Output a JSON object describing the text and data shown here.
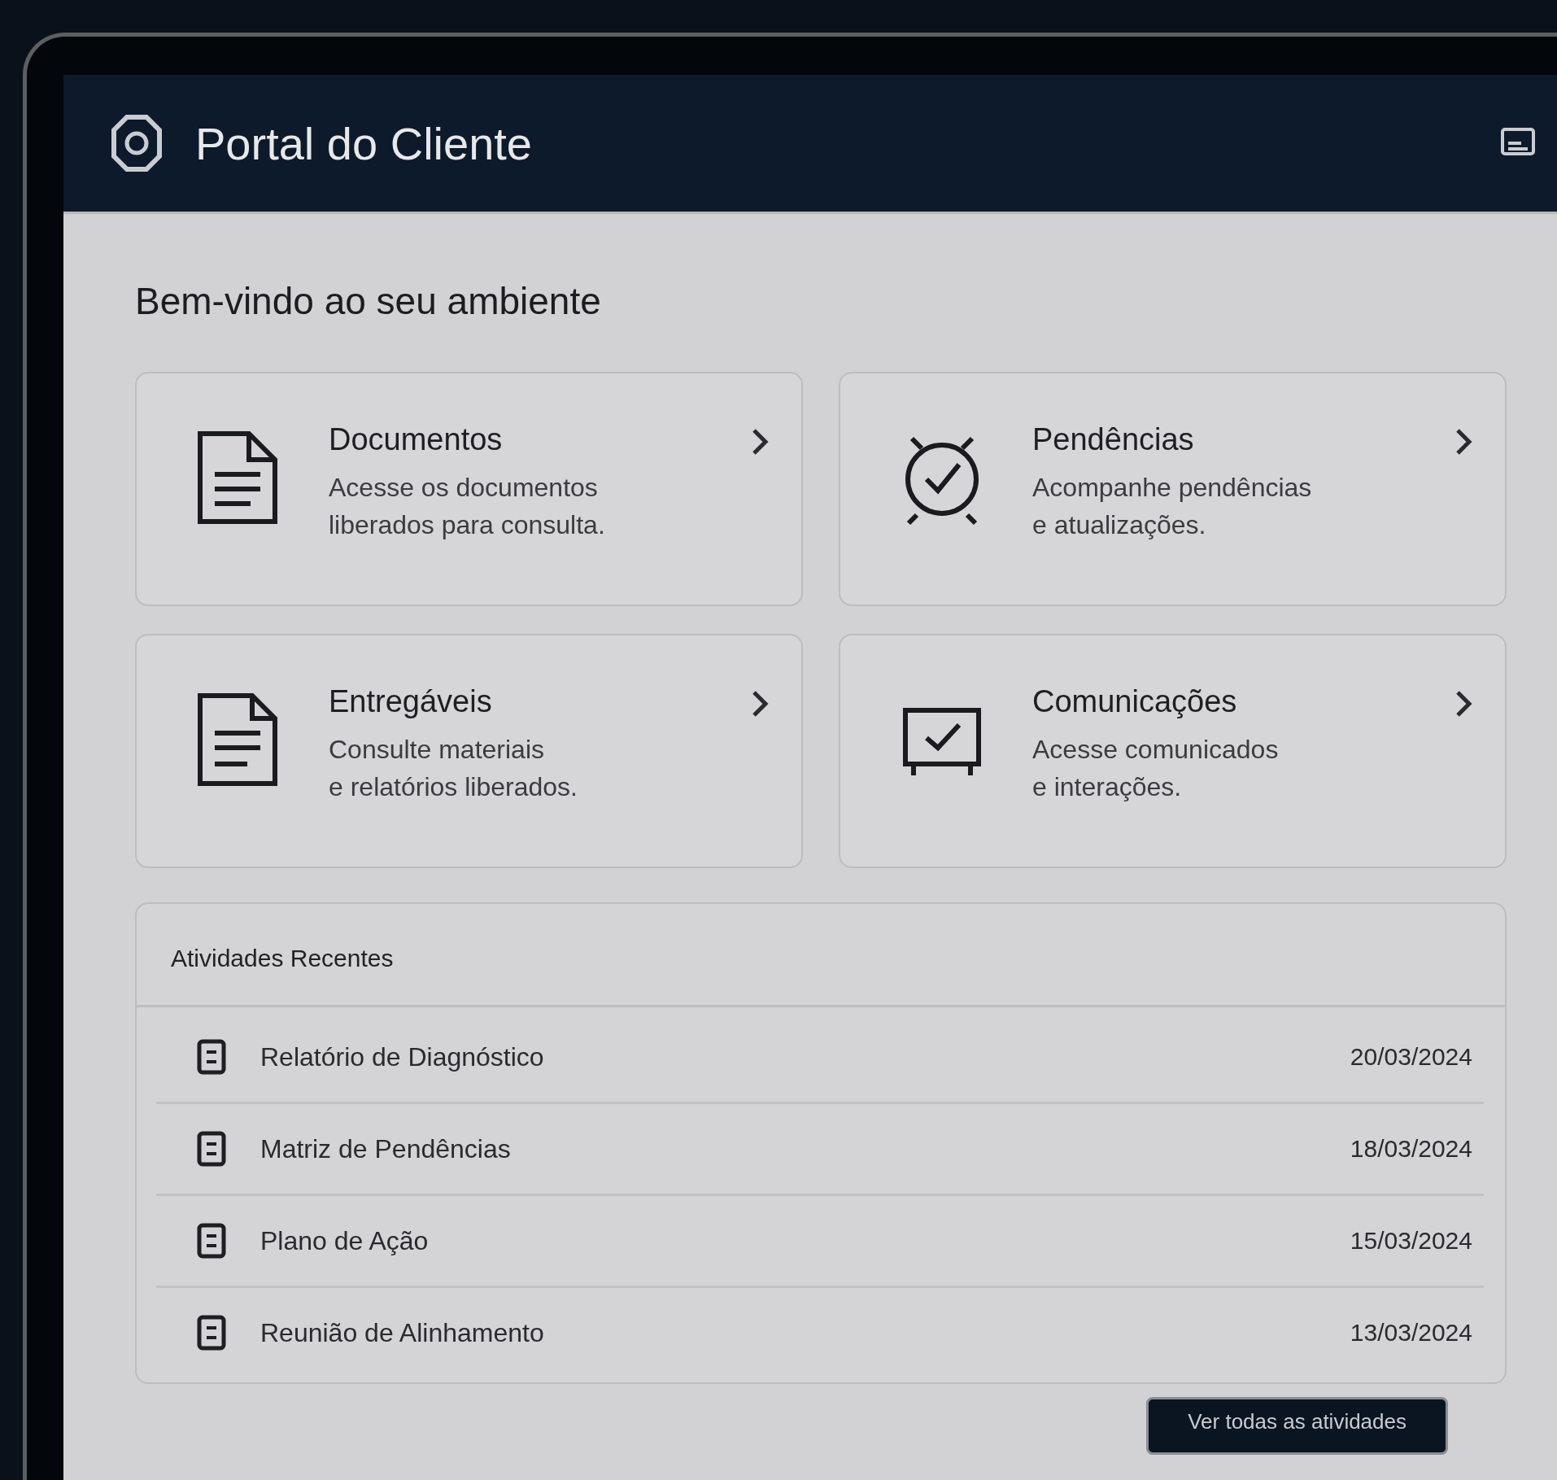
{
  "header": {
    "title": "Portal do Cliente"
  },
  "welcome": "Bem-vindo ao seu ambiente",
  "cards": [
    {
      "kind": "document",
      "title": "Documentos",
      "description": [
        "Acesse os documentos",
        "liberados para consulta."
      ]
    },
    {
      "kind": "pending",
      "title": "Pendências",
      "description": [
        "Acompanhe pendências",
        "e atualizações."
      ]
    },
    {
      "kind": "deliverable",
      "title": "Entregáveis",
      "description": [
        "Consulte materiais",
        "e relatórios liberados."
      ]
    },
    {
      "kind": "message",
      "title": "Comunicações",
      "description": [
        "Acesse comunicados",
        "e interações."
      ]
    }
  ],
  "activities": {
    "title": "Atividades Recentes",
    "rows": [
      {
        "name": "Relatório de Diagnóstico",
        "date": "20/03/2024"
      },
      {
        "name": "Matriz de Pendências",
        "date": "18/03/2024"
      },
      {
        "name": "Plano de Ação",
        "date": "15/03/2024"
      },
      {
        "name": "Reunião de Alinhamento",
        "date": "13/03/2024"
      }
    ],
    "button": "Ver todas as atividades"
  }
}
